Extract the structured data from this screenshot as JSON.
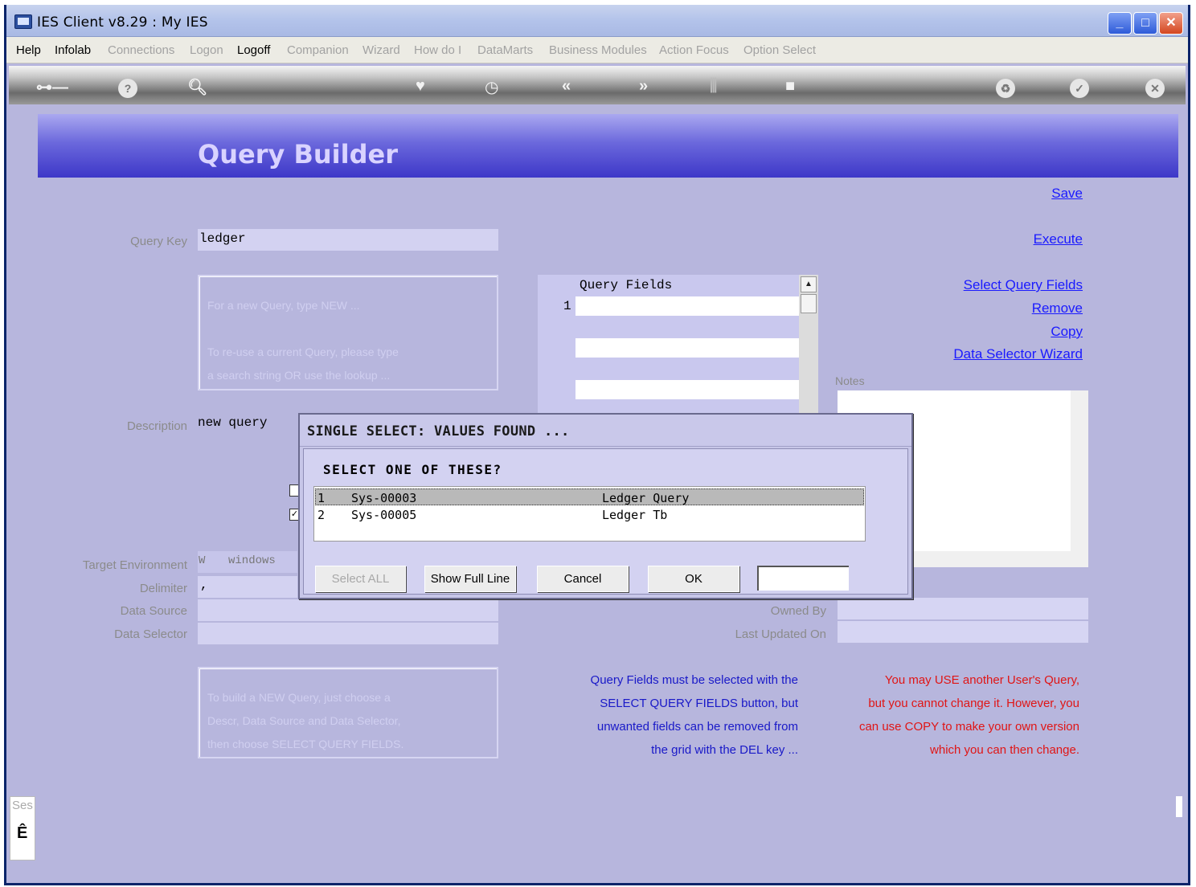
{
  "window": {
    "title": "IES Client v8.29 : My IES"
  },
  "menubar": {
    "items": [
      {
        "label": "Help",
        "enabled": true
      },
      {
        "label": "Infolab",
        "enabled": true
      },
      {
        "label": "Connections",
        "enabled": false
      },
      {
        "label": "Logon",
        "enabled": false
      },
      {
        "label": "Logoff",
        "enabled": true
      },
      {
        "label": "Companion",
        "enabled": false
      },
      {
        "label": "Wizard",
        "enabled": false
      },
      {
        "label": "How do I",
        "enabled": false
      },
      {
        "label": "DataMarts",
        "enabled": false
      },
      {
        "label": "Business Modules",
        "enabled": false
      },
      {
        "label": "Action Focus",
        "enabled": false
      },
      {
        "label": "Option Select",
        "enabled": false
      }
    ]
  },
  "toolbar": {
    "icons": [
      "key-icon",
      "help-icon",
      "search-icon",
      "heart-icon",
      "clock-icon",
      "back-icon",
      "forward-icon",
      "columns-icon",
      "stop-icon",
      "recycle-icon",
      "check-icon",
      "close-icon"
    ]
  },
  "page": {
    "title": "Query Builder"
  },
  "form": {
    "query_key_label": "Query Key",
    "query_key_value": "ledger",
    "hint1_line1": "For a new Query, type NEW ...",
    "hint1_line2": "To re-use a current Query, please type",
    "hint1_line3": "a search string OR use the lookup ...",
    "description_label": "Description",
    "description_value": "new query",
    "target_env_label": "Target Environment",
    "target_env_prefix": "W",
    "target_env_value": "windows",
    "delimiter_label": "Delimiter",
    "delimiter_value": ",",
    "data_source_label": "Data Source",
    "data_source_value": "",
    "data_selector_label": "Data Selector",
    "data_selector_value": "",
    "hint2_line1": "To build a NEW Query, just choose a",
    "hint2_line2": "Descr, Data Source and Data Selector,",
    "hint2_line3": "then choose SELECT QUERY FIELDS.",
    "owned_by_label": "Owned By",
    "last_updated_label": "Last Updated On",
    "notes_label": "Notes"
  },
  "grid": {
    "header": "Query Fields",
    "row_numbers": [
      "1"
    ]
  },
  "links": {
    "save": "Save",
    "execute": "Execute",
    "select_query_fields": "Select Query Fields",
    "remove": "Remove",
    "copy": "Copy",
    "data_selector_wizard": "Data Selector Wizard"
  },
  "notes": {
    "blue": [
      "Query Fields must be selected with the",
      "SELECT QUERY FIELDS button, but",
      "unwanted fields can be removed from",
      "the grid with the DEL key ..."
    ],
    "red": [
      "You may USE another User's Query,",
      "but you cannot change it. However, you",
      "can use COPY to make your own version",
      "which you can then change."
    ]
  },
  "dialog": {
    "title": "SINGLE SELECT: VALUES FOUND ...",
    "prompt": "SELECT ONE OF THESE?",
    "rows": [
      {
        "num": "1",
        "code": "Sys-00003",
        "desc": "Ledger Query",
        "selected": true
      },
      {
        "num": "2",
        "code": "Sys-00005",
        "desc": "Ledger Tb",
        "selected": false
      }
    ],
    "buttons": {
      "select_all": "Select ALL",
      "show_full_line": "Show Full Line",
      "cancel": "Cancel",
      "ok": "OK"
    }
  },
  "status": {
    "session_fragment": "Ses",
    "glyph": "Ê"
  }
}
